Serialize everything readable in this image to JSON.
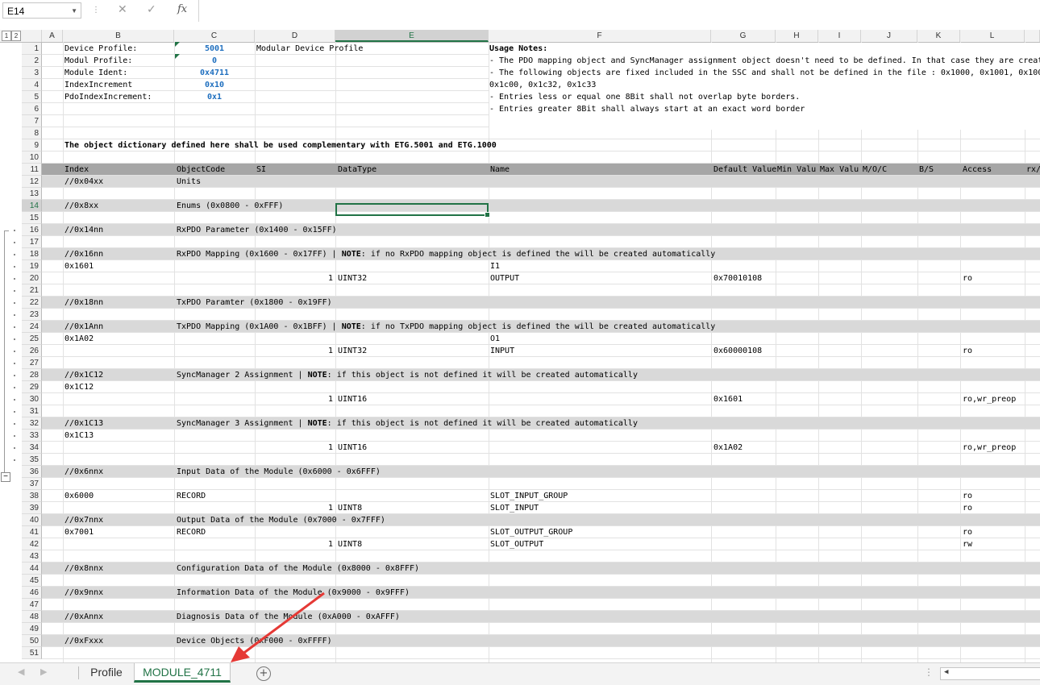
{
  "formula_bar": {
    "name_box": "E14",
    "fx": "fx",
    "formula": ""
  },
  "outline_levels": [
    "1",
    "2"
  ],
  "columns": [
    {
      "id": "A",
      "label": "A"
    },
    {
      "id": "B",
      "label": "B"
    },
    {
      "id": "C",
      "label": "C"
    },
    {
      "id": "D",
      "label": "D"
    },
    {
      "id": "E",
      "label": "E"
    },
    {
      "id": "F",
      "label": "F"
    },
    {
      "id": "G",
      "label": "G"
    },
    {
      "id": "H",
      "label": "H"
    },
    {
      "id": "I",
      "label": "I"
    },
    {
      "id": "J",
      "label": "J"
    },
    {
      "id": "K",
      "label": "K"
    },
    {
      "id": "L",
      "label": "L"
    }
  ],
  "header_info": [
    {
      "label": "Device Profile:",
      "value": "5001",
      "desc": "Modular Device Profile"
    },
    {
      "label": "Modul Profile:",
      "value": "0",
      "desc": ""
    },
    {
      "label": "Module Ident:",
      "value": "0x4711",
      "desc": ""
    },
    {
      "label": "IndexIncrement",
      "value": "0x10",
      "desc": ""
    },
    {
      "label": "PdoIndexIncrement:",
      "value": "0x1",
      "desc": ""
    }
  ],
  "usage_notes": [
    "Usage Notes:",
    "- The PDO mapping object and SyncManager assignment object doesn't need to be defined. In that case they are creat",
    "- The following objects are fixed included in the SSC and shall not be defined in the file : 0x1000, 0x1001, 0x100",
    "0x1c00, 0x1c32, 0x1c33",
    "- Entries less or equal one 8Bit shall not overlap byte borders.",
    "- Entries greater 8Bit shall always start at an exact word border"
  ],
  "complement_note": "The object dictionary defined here shall be used complementary with ETG.5001 and ETG.1000",
  "table_header": [
    "Index",
    "ObjectCode",
    "SI",
    "DataType",
    "Name",
    "Default Value",
    "Min Valu",
    "Max Valu",
    "M/O/C",
    "B/S",
    "Access",
    "rx/"
  ],
  "rows": [
    {
      "n": "1"
    },
    {
      "n": "2"
    },
    {
      "n": "3"
    },
    {
      "n": "4"
    },
    {
      "n": "5"
    },
    {
      "n": "6"
    },
    {
      "n": "7"
    },
    {
      "n": "8"
    },
    {
      "n": "9"
    },
    {
      "n": "10"
    },
    {
      "n": "11"
    },
    {
      "n": "12",
      "style": "gray",
      "b": "//0x04xx",
      "c": "Units"
    },
    {
      "n": "13"
    },
    {
      "n": "14",
      "style": "gray",
      "b": "//0x8xx",
      "c": "Enums (0x0800 - 0xFFF)"
    },
    {
      "n": "15"
    },
    {
      "n": "16",
      "style": "gray",
      "b": "//0x14nn",
      "c": "RxPDO Parameter (0x1400 - 0x15FF)"
    },
    {
      "n": "17"
    },
    {
      "n": "18",
      "style": "gray",
      "b": "//0x16nn",
      "c": "RxPDO Mapping (0x1600 - 0x17FF) | ",
      "c_bold": "NOTE",
      "c_tail": ": if no RxPDO mapping object is defined the will  be created automatically"
    },
    {
      "n": "19",
      "b": "0x1601",
      "f": "I1"
    },
    {
      "n": "20",
      "d": "1",
      "e": "UINT32",
      "f": "OUTPUT",
      "g": "0x70010108",
      "l": "ro"
    },
    {
      "n": "21"
    },
    {
      "n": "22",
      "style": "gray",
      "b": "//0x18nn",
      "c": "TxPDO Paramter (0x1800 - 0x19FF)"
    },
    {
      "n": "23"
    },
    {
      "n": "24",
      "style": "gray",
      "b": "//0x1Ann",
      "c": "TxPDO Mapping (0x1A00 - 0x1BFF) | ",
      "c_bold": "NOTE",
      "c_tail": ": if no TxPDO mapping object is defined the will  be created automatically"
    },
    {
      "n": "25",
      "b": "0x1A02",
      "f": "O1"
    },
    {
      "n": "26",
      "d": "1",
      "e": "UINT32",
      "f": "INPUT",
      "g": "0x60000108",
      "l": "ro"
    },
    {
      "n": "27"
    },
    {
      "n": "28",
      "style": "gray",
      "b": "//0x1C12",
      "c": "SyncManager 2 Assignment | ",
      "c_bold": "NOTE",
      "c_tail": ": if this object is not defined it will  be created automatically"
    },
    {
      "n": "29",
      "b": "0x1C12"
    },
    {
      "n": "30",
      "d": "1",
      "e": "UINT16",
      "g": "0x1601",
      "l": "ro,wr_preop"
    },
    {
      "n": "31"
    },
    {
      "n": "32",
      "style": "gray",
      "b": "//0x1C13",
      "c": "SyncManager 3 Assignment | ",
      "c_bold": "NOTE",
      "c_tail": ": if this object is not defined it will  be created automatically"
    },
    {
      "n": "33",
      "b": "0x1C13"
    },
    {
      "n": "34",
      "d": "1",
      "e": "UINT16",
      "g": "0x1A02",
      "l": "ro,wr_preop"
    },
    {
      "n": "35"
    },
    {
      "n": "36",
      "style": "gray",
      "b": "//0x6nnx",
      "c": "Input Data of the Module (0x6000 - 0x6FFF)"
    },
    {
      "n": "37"
    },
    {
      "n": "38",
      "b": "0x6000",
      "c": "RECORD",
      "f": "SLOT_INPUT_GROUP",
      "l": "ro"
    },
    {
      "n": "39",
      "d": "1",
      "e": "UINT8",
      "f": "SLOT_INPUT",
      "l": "ro"
    },
    {
      "n": "40",
      "style": "gray",
      "b": "//0x7nnx",
      "c": "Output Data of the Module (0x7000 - 0x7FFF)"
    },
    {
      "n": "41",
      "b": "0x7001",
      "c": "RECORD",
      "f": "SLOT_OUTPUT_GROUP",
      "l": "ro"
    },
    {
      "n": "42",
      "d": "1",
      "e": "UINT8",
      "f": "SLOT_OUTPUT",
      "l": "rw"
    },
    {
      "n": "43"
    },
    {
      "n": "44",
      "style": "gray",
      "b": "//0x8nnx",
      "c": "Configuration Data of the Module (0x8000 - 0x8FFF)"
    },
    {
      "n": "45"
    },
    {
      "n": "46",
      "style": "gray",
      "b": "//0x9nnx",
      "c": "Information Data of the Module (0x9000 - 0x9FFF)"
    },
    {
      "n": "47"
    },
    {
      "n": "48",
      "style": "gray",
      "b": "//0xAnnx",
      "c": "Diagnosis Data of the Module (0xA000 - 0xAFFF)"
    },
    {
      "n": "49"
    },
    {
      "n": "50",
      "style": "gray",
      "b": "//0xFxxx",
      "c": "Device Objects (0xF000 - 0xFFFF)"
    },
    {
      "n": "51"
    }
  ],
  "sheet_tabs": {
    "tab1": "Profile",
    "tab2": "MODULE_4711",
    "active": "MODULE_4711"
  },
  "colors": {
    "accent": "#217346",
    "value_blue": "#1f6fbf",
    "gray_row": "#d9d9d9",
    "header_row": "#a6a6a6",
    "arrow": "#e53935"
  }
}
